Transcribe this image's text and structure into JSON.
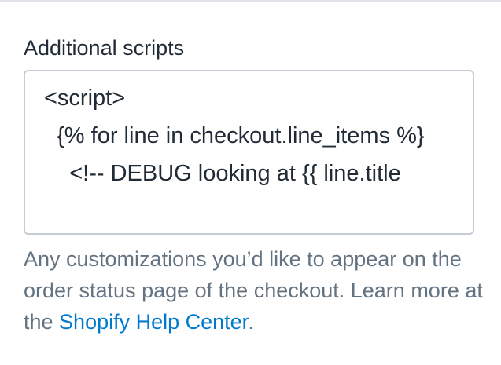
{
  "field": {
    "label": "Additional scripts",
    "value": "<script>\n  {% for line in checkout.line_items %}\n    <!-- DEBUG looking at {{ line.title"
  },
  "help": {
    "text": "Any customizations you’d like to appear on the order status page of the checkout. Learn more at the ",
    "link_label": "Shopify Help Center",
    "trailing": "."
  },
  "colors": {
    "label_text": "#212b36",
    "help_text": "#637381",
    "link": "#007ace",
    "border": "#c4cdd5"
  }
}
